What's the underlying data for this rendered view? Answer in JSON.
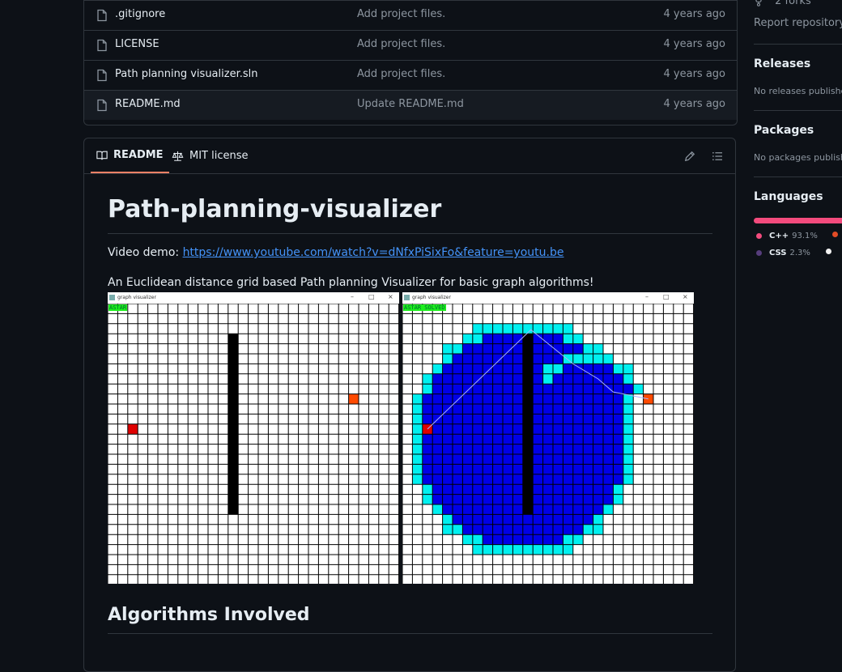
{
  "files": [
    {
      "name": ".gitignore",
      "message": "Add project files.",
      "age": "4 years ago"
    },
    {
      "name": "LICENSE",
      "message": "Add project files.",
      "age": "4 years ago"
    },
    {
      "name": "Path planning visualizer.sln",
      "message": "Add project files.",
      "age": "4 years ago"
    },
    {
      "name": "README.md",
      "message": "Update README.md",
      "age": "4 years ago"
    }
  ],
  "readme_tabs": {
    "readme": "README",
    "license": "MIT license"
  },
  "readme": {
    "title": "Path-planning-visualizer",
    "demo_label": "Video demo:",
    "demo_link": "https://www.youtube.com/watch?v=dNfxPiSixFo&feature=youtu.be",
    "description": "An Euclidean distance grid based Path planning Visualizer for basic graph algorithms!",
    "screenshot_title": "graph visualizer",
    "left_label": "ASTAR",
    "right_label": "ASTAR SOLVED",
    "section_title": "Algorithms Involved"
  },
  "sidebar": {
    "forks": "2 forks",
    "report": "Report repository",
    "releases_title": "Releases",
    "releases_text": "No releases published",
    "packages_title": "Packages",
    "packages_text": "No packages published",
    "languages_title": "Languages",
    "languages": [
      {
        "name": "C++",
        "percent": "93.1%",
        "color": "#f34b7d"
      },
      {
        "name": "CSS",
        "percent": "2.3%",
        "color": "#563d7c"
      }
    ]
  }
}
